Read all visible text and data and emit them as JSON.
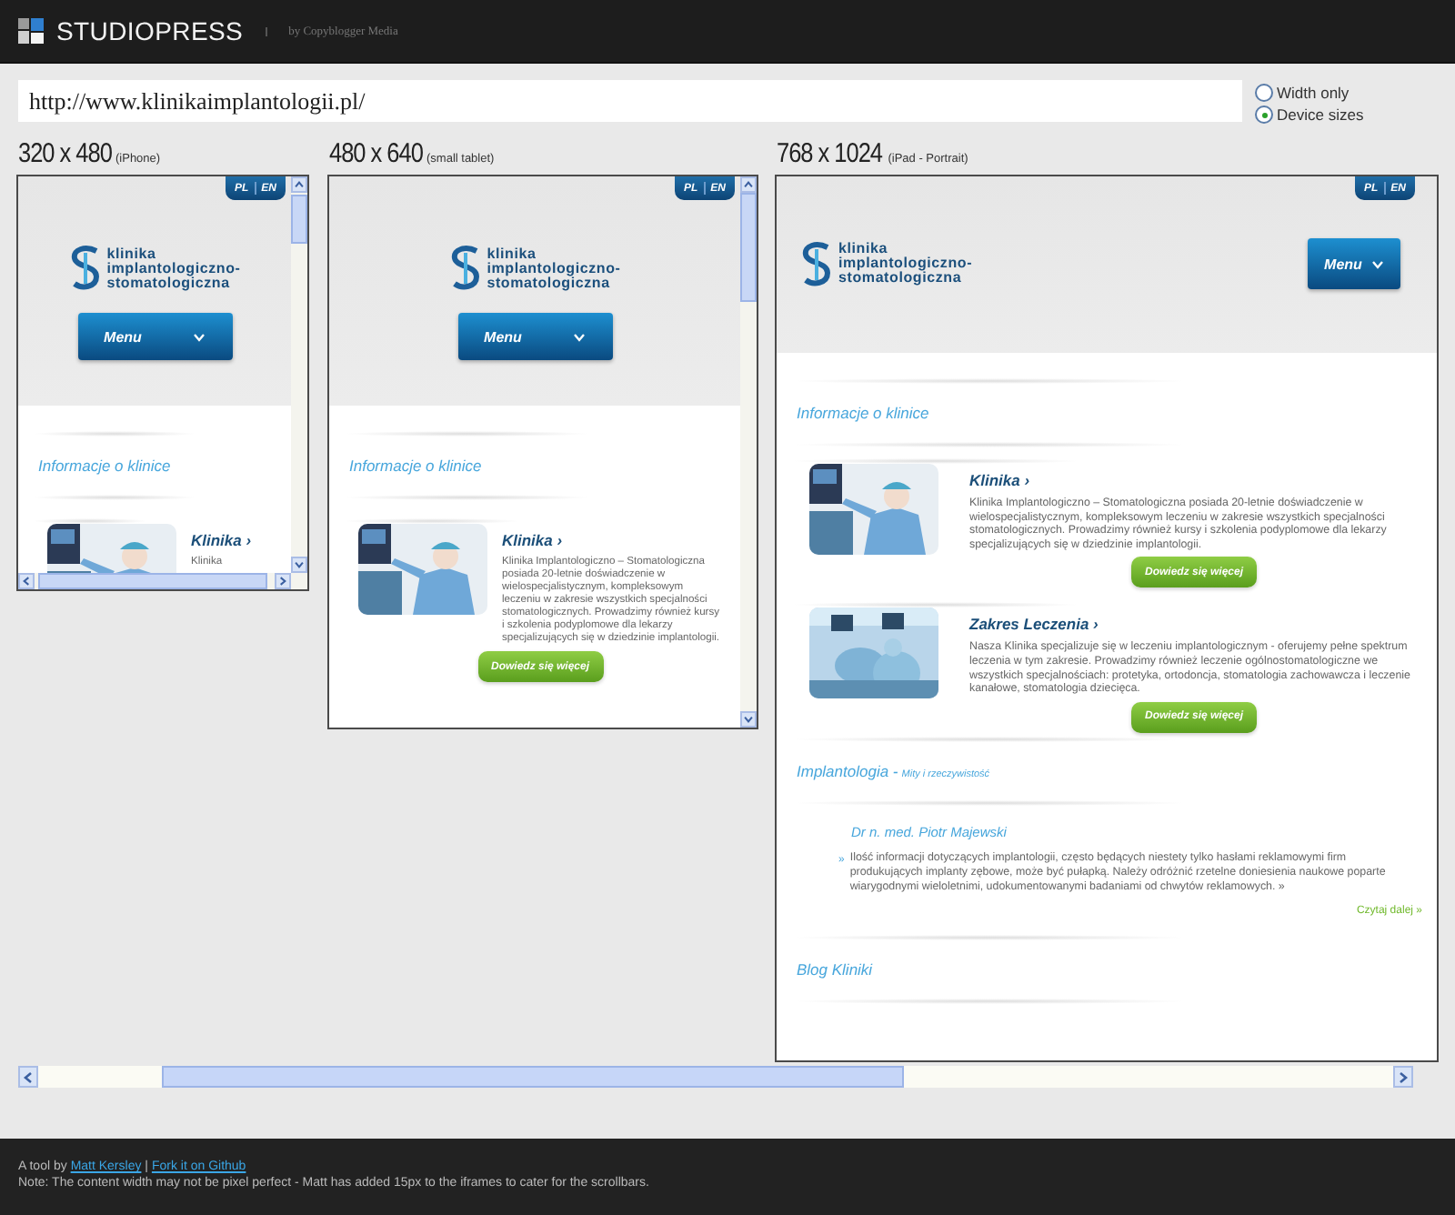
{
  "header": {
    "brand": "STUDIOPRESS",
    "tagline": "by Copyblogger Media"
  },
  "url_field": {
    "value": "http://www.klinikaimplantologii.pl/"
  },
  "size_options": [
    {
      "label": "Width only",
      "selected": false
    },
    {
      "label": "Device sizes",
      "selected": true
    }
  ],
  "devices": [
    {
      "kind": "phone",
      "size": "320 x 480",
      "name": "(iPhone)",
      "site": {
        "languages": [
          "PL",
          "EN"
        ],
        "logo_lines": [
          "klinika",
          "implantologiczno-",
          "stomatologiczna"
        ],
        "menu": "Menu",
        "sections": [
          {
            "kind": "articles",
            "heading": "Informacje o klinice",
            "articles": [
              {
                "title": "Klinika ›",
                "text": "Klinika"
              }
            ]
          }
        ]
      }
    },
    {
      "kind": "tablet",
      "size": "480 x 640",
      "name": "(small tablet)",
      "site": {
        "languages": [
          "PL",
          "EN"
        ],
        "logo_lines": [
          "klinika",
          "implantologiczno-",
          "stomatologiczna"
        ],
        "menu": "Menu",
        "sections": [
          {
            "kind": "articles",
            "heading": "Informacje o klinice",
            "articles": [
              {
                "title": "Klinika ›",
                "text": "Klinika Implantologiczno – Stomatologiczna posiada 20-letnie doświadczenie w wielospecjalistycznym, kompleksowym leczeniu w zakresie wszystkich specjalności stomatologicznych. Prowadzimy również kursy i szkolenia podyplomowe dla lekarzy specjalizujących się w dziedzinie implantologii.",
                "button": "Dowiedz się więcej"
              }
            ]
          }
        ]
      }
    },
    {
      "kind": "ipad",
      "size": "768 x 1024",
      "name": "(iPad - Portrait)",
      "site": {
        "languages": [
          "PL",
          "EN"
        ],
        "logo_lines": [
          "klinika",
          "implantologiczno-",
          "stomatologiczna"
        ],
        "menu": "Menu",
        "sections": [
          {
            "kind": "articles",
            "heading": "Informacje o klinice",
            "articles": [
              {
                "title": "Klinika ›",
                "text": "Klinika Implantologiczno – Stomatologiczna posiada 20-letnie doświadczenie w wielospecjalistycznym, kompleksowym leczeniu w zakresie wszystkich specjalności stomatologicznych. Prowadzimy również kursy i szkolenia podyplomowe dla lekarzy specjalizujących się w dziedzinie implantologii.",
                "button": "Dowiedz się więcej"
              },
              {
                "title": "Zakres Leczenia ›",
                "text": "Nasza Klinika specjalizuje się w leczeniu implantologicznym - oferujemy pełne spektrum leczenia w tym zakresie. Prowadzimy również leczenie ogólnostomatologiczne we wszystkich specjalnościach: protetyka, ortodoncja, stomatologia zachowawcza i leczenie kanałowe, stomatologia dziecięca.",
                "button": "Dowiedz się więcej"
              }
            ]
          },
          {
            "kind": "quote",
            "heading": "Implantologia -",
            "subheading": "Mity i rzeczywistość",
            "author": "Dr n. med. Piotr Majewski",
            "mark": "»",
            "quote": "Ilość informacji dotyczących implantologii, często będących niestety tylko hasłami reklamowymi firm produkujących implanty zębowe, może być pułapką. Należy odróżnić rzetelne doniesienia naukowe poparte wiarygodnymi wieloletnimi, udokumentowanymi badaniami od chwytów reklamowych. »",
            "link": "Czytaj dalej »"
          },
          {
            "kind": "heading",
            "heading": "Blog Kliniki"
          }
        ]
      }
    }
  ],
  "footer": {
    "prefix": "A tool by",
    "links": [
      "Matt Kersley",
      "Fork it on Github"
    ],
    "separator": "|",
    "note": "Note: The content width may not be pixel perfect - Matt has added 15px to the iframes to cater for the scrollbars."
  }
}
